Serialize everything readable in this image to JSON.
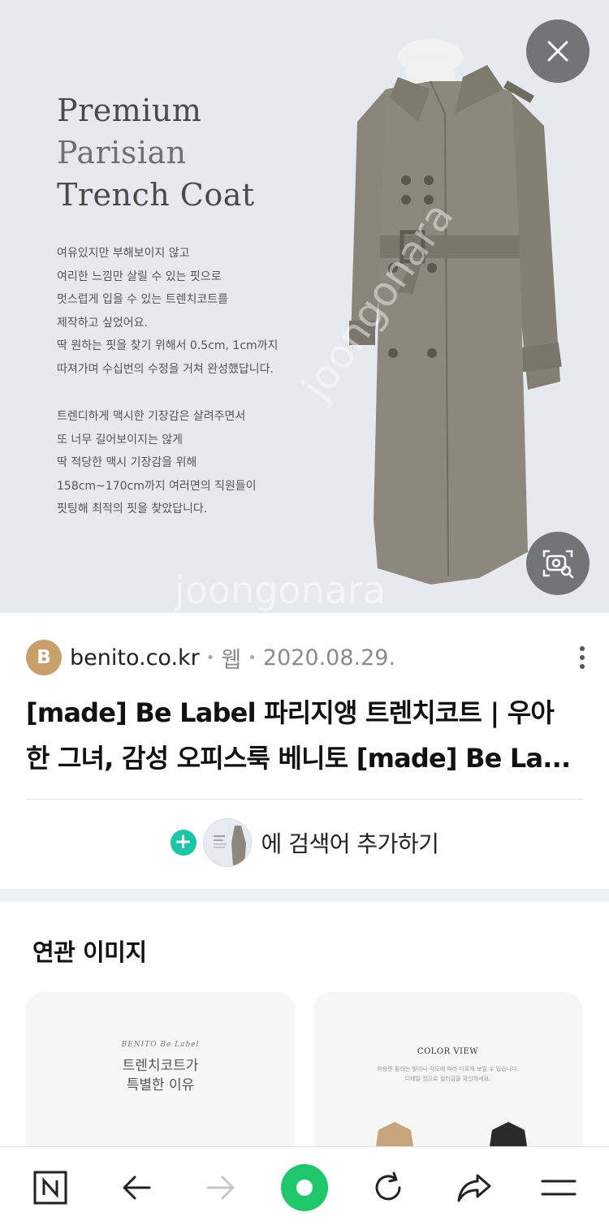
{
  "hero": {
    "title_line1": "Premium",
    "title_line2": "Parisian",
    "title_line3": "Trench Coat",
    "para1": [
      "여유있지만 부해보이지 않고",
      "여리한 느낌만 살릴 수 있는 핏으로",
      "멋스럽게 입을 수 있는 트렌치코트를",
      "제작하고 싶었어요.",
      "딱 원하는 핏을 찾기 위해서 0.5cm, 1cm까지",
      "따져가며 수십번의 수정을 거쳐 완성했답니다."
    ],
    "para2": [
      "트렌디하게 맥시한 기장감은 살려주면서",
      "또 너무 길어보이지는 않게",
      "딱 적당한 맥시 기장감을 위해",
      "158cm~170cm까지 여러면의 직원들이",
      "핏팅해 최적의 핏을 찾았답니다."
    ],
    "watermark": "joongonara",
    "background_color": "#e6e9ef"
  },
  "source": {
    "avatar_letter": "B",
    "domain": "benito.co.kr",
    "type": "웹",
    "date": "2020.08.29.",
    "avatar_color": "#c9a06a"
  },
  "result": {
    "title_line1": "[made] Be Label 파리지앵 트렌치코트 | 우아",
    "title_line2": "한 그녀, 감성 오피스룩 베니토 [made] Be La..."
  },
  "add_keyword": {
    "label": "에 검색어 추가하기",
    "accent": "#19c6a6"
  },
  "related": {
    "title": "연관 이미지",
    "cards": [
      {
        "brand": "BENITO Be Label",
        "line1": "트렌치코트가",
        "line2": "특별한 이유"
      },
      {
        "heading": "COLOR VIEW",
        "sub1": "착용핏 필러는 빛이나 각도에 따라 다르게 보일 수 있습니다.",
        "sub2": "디테일 컷으로 컬러감을 확인하세요."
      }
    ]
  },
  "bottom_nav": {
    "items": [
      "naver-home-icon",
      "back-arrow-icon",
      "forward-arrow-icon",
      "green-dot-icon",
      "refresh-icon",
      "share-icon",
      "menu-icon"
    ],
    "accent": "#1ec86a"
  }
}
